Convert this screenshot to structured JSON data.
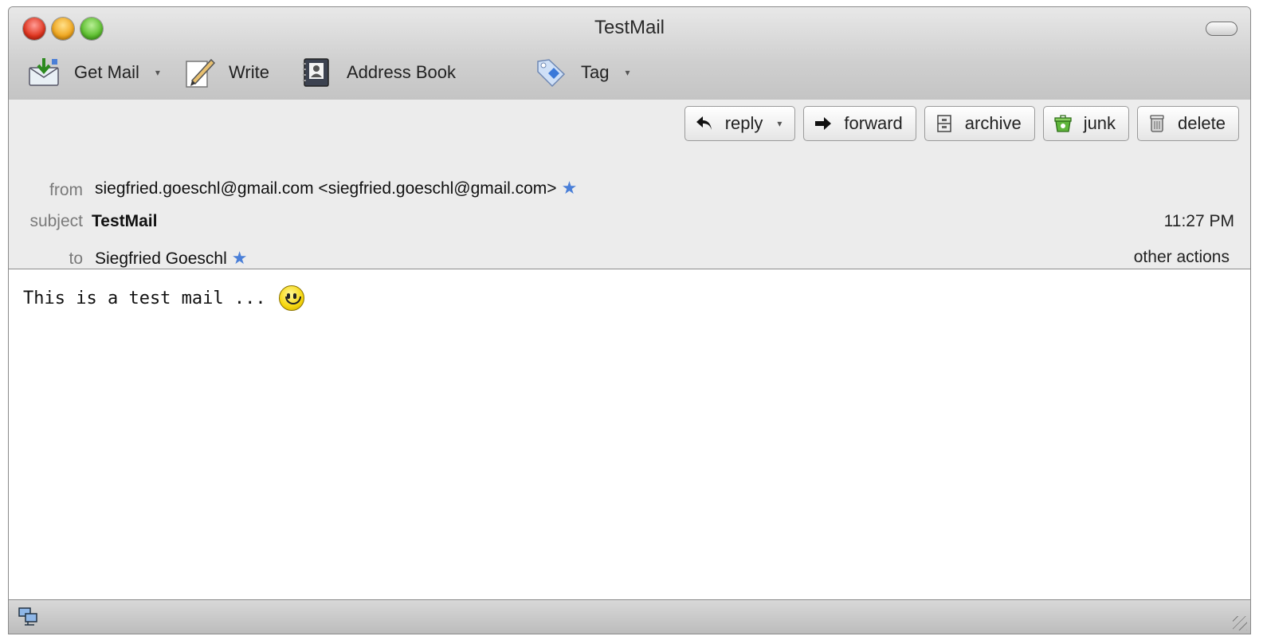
{
  "window": {
    "title": "TestMail"
  },
  "toolbar": {
    "get_mail": "Get Mail",
    "write": "Write",
    "address_book": "Address Book",
    "tag": "Tag",
    "dropdown_glyph": "▾"
  },
  "actions": {
    "reply": "reply",
    "forward": "forward",
    "archive": "archive",
    "junk": "junk",
    "delete": "delete"
  },
  "header": {
    "from_label": "from",
    "from_value": "siegfried.goeschl@gmail.com <siegfried.goeschl@gmail.com>",
    "subject_label": "subject",
    "subject_value": "TestMail",
    "time": "11:27 PM",
    "to_label": "to",
    "to_value": "Siegfried Goeschl",
    "other_actions": "other actions",
    "star_glyph": "★"
  },
  "message": {
    "body": "This is a test mail ..."
  },
  "colors": {
    "star": "#4a7fd8",
    "header_bg": "#ececec",
    "chrome_bg": "#cfcfcf"
  },
  "icons": [
    "get-mail-icon",
    "write-icon",
    "address-book-icon",
    "tag-icon",
    "reply-icon",
    "forward-icon",
    "archive-icon",
    "junk-icon",
    "delete-icon",
    "smiley-icon",
    "network-status-icon"
  ]
}
